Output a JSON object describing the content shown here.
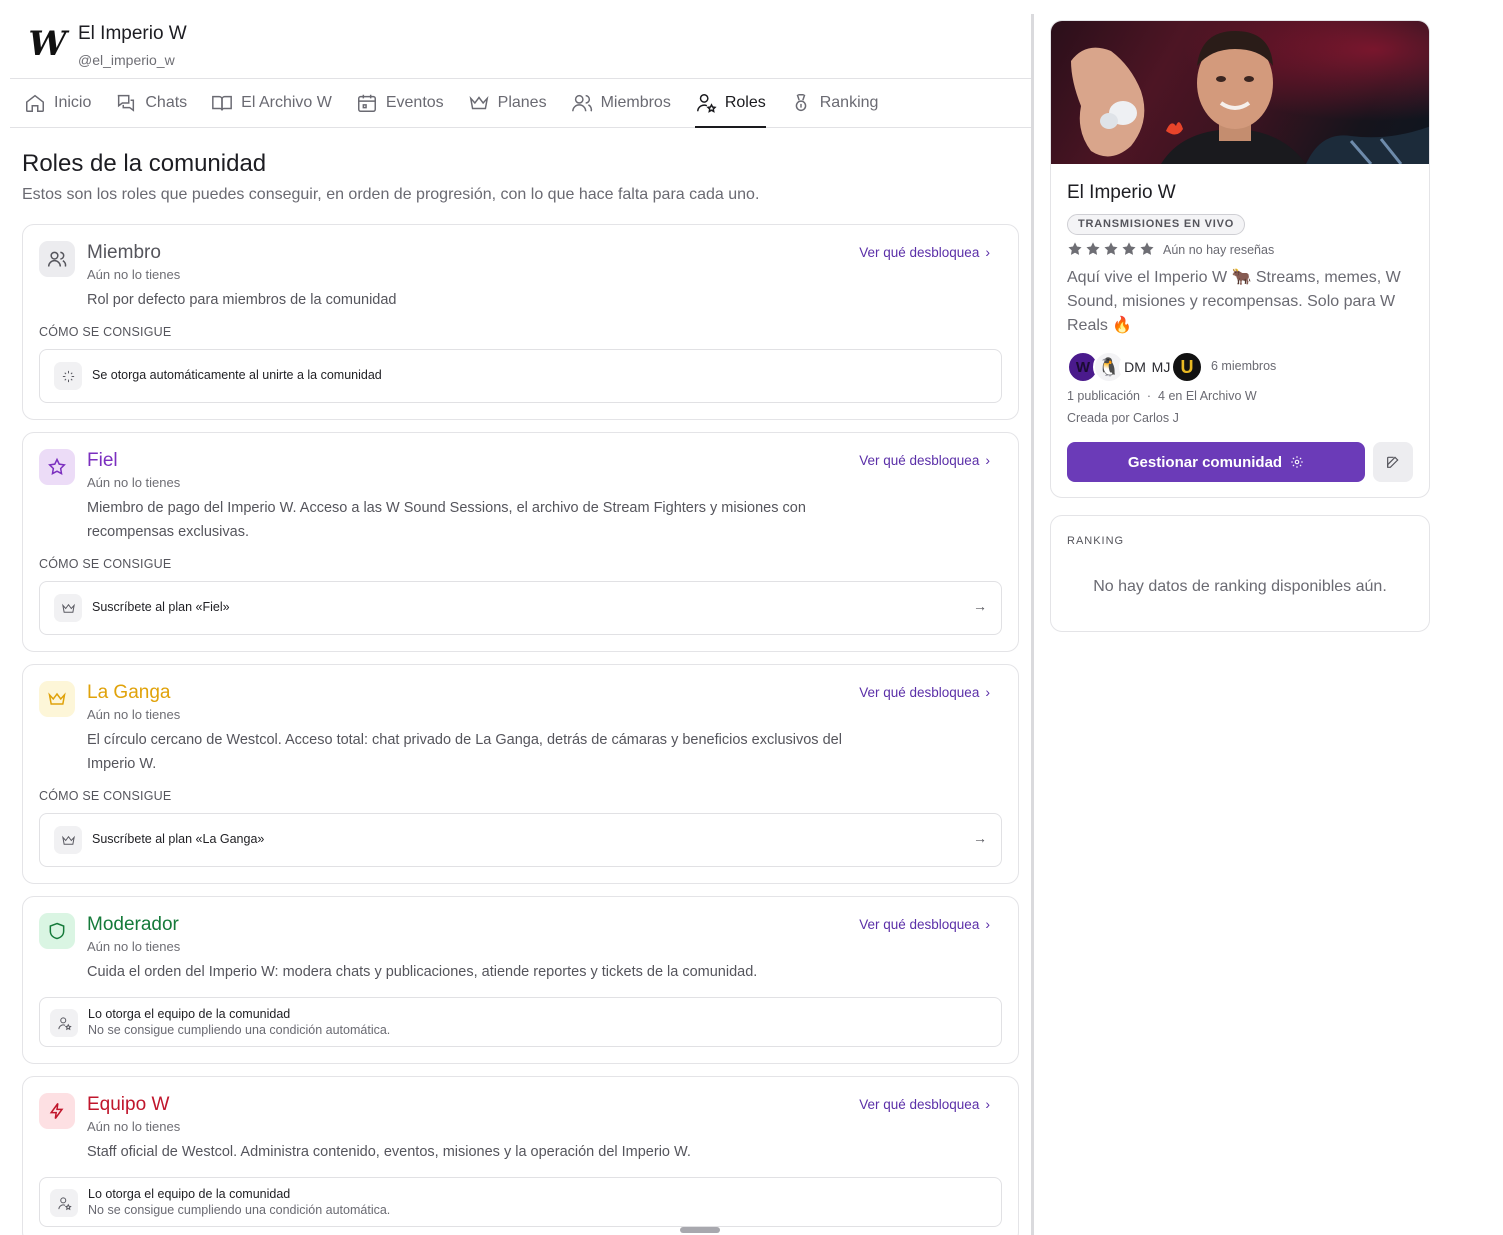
{
  "community": {
    "name": "El Imperio W",
    "handle": "@el_imperio_w",
    "logo_letter": "W"
  },
  "tabs": [
    {
      "label": "Inicio",
      "icon": "home-icon",
      "active": false
    },
    {
      "label": "Chats",
      "icon": "chats-icon",
      "active": false
    },
    {
      "label": "El Archivo W",
      "icon": "book-icon",
      "active": false
    },
    {
      "label": "Eventos",
      "icon": "calendar-icon",
      "active": false
    },
    {
      "label": "Planes",
      "icon": "crown-icon",
      "active": false
    },
    {
      "label": "Miembros",
      "icon": "users-icon",
      "active": false
    },
    {
      "label": "Roles",
      "icon": "user-star-icon",
      "active": true
    },
    {
      "label": "Ranking",
      "icon": "medal-icon",
      "active": false
    }
  ],
  "page": {
    "title": "Roles de la comunidad",
    "subtitle": "Estos son los roles que puedes conseguir, en orden de progresión, con lo que hace falta para cada uno."
  },
  "labels": {
    "unlock": "Ver qué desbloquea",
    "how": "CÓMO SE CONSIGUE"
  },
  "roles": [
    {
      "name": "Miembro",
      "status": "Aún no lo tienes",
      "description": "Rol por defecto para miembros de la comunidad",
      "color": "#55555c",
      "icon_bg": "#ececef",
      "icon": "users-icon",
      "requirement": "Se otorga automáticamente al unirte a la comunidad",
      "requirement_icon": "sparkles-icon"
    },
    {
      "name": "Fiel",
      "status": "Aún no lo tienes",
      "description": "Miembro de pago del Imperio W. Acceso a las W Sound Sessions, el archivo de Stream Fighters y misiones con recompensas exclusivas.",
      "color": "#7b2fbf",
      "icon_bg": "#ecdcf7",
      "icon": "star-icon",
      "requirement": "Suscríbete al plan «Fiel»",
      "requirement_icon": "crown-icon"
    },
    {
      "name": "La Ganga",
      "status": "Aún no lo tienes",
      "description": "El círculo cercano de Westcol. Acceso total: chat privado de La Ganga, detrás de cámaras y beneficios exclusivos del Imperio W.",
      "color": "#e0a20a",
      "icon_bg": "#fdf6d8",
      "icon": "crown-icon",
      "requirement": "Suscríbete al plan «La Ganga»",
      "requirement_icon": "crown-icon"
    },
    {
      "name": "Moderador",
      "status": "Aún no lo tienes",
      "description": "Cuida el orden del Imperio W: modera chats y publicaciones, atiende reportes y tickets de la comunidad.",
      "color": "#157a3a",
      "icon_bg": "#daf5e3",
      "icon": "shield-icon",
      "requirement": "Lo otorga el equipo de la comunidad",
      "requirement_sub": "No se consigue cumpliendo una condición automática.",
      "requirement_icon": "user-star-icon"
    },
    {
      "name": "Equipo W",
      "status": "Aún no lo tienes",
      "description": "Staff oficial de Westcol. Administra contenido, eventos, misiones y la operación del Imperio W.",
      "color": "#c0162c",
      "icon_bg": "#fde0e3",
      "icon": "bolt-icon",
      "requirement": "Lo otorga el equipo de la comunidad",
      "requirement_sub": "No se consigue cumpliendo una condición automática.",
      "requirement_icon": "user-star-icon"
    }
  ],
  "sidebar": {
    "name": "El Imperio W",
    "badge": "TRANSMISIONES EN VIVO",
    "reviews": "Aún no hay reseñas",
    "description": "Aquí vive el Imperio W 🐂 Streams, memes, W Sound, misiones y recompensas. Solo para W Reals 🔥",
    "avatars": [
      "W",
      "🐧",
      "DM",
      "MJ",
      "U"
    ],
    "members": "6 miembros",
    "posts": "1 publicación  ·  4 en El Archivo W",
    "creator": "Creada por Carlos J",
    "manage_label": "Gestionar comunidad"
  },
  "ranking": {
    "title": "RANKING",
    "empty": "No hay datos de ranking disponibles aún."
  }
}
